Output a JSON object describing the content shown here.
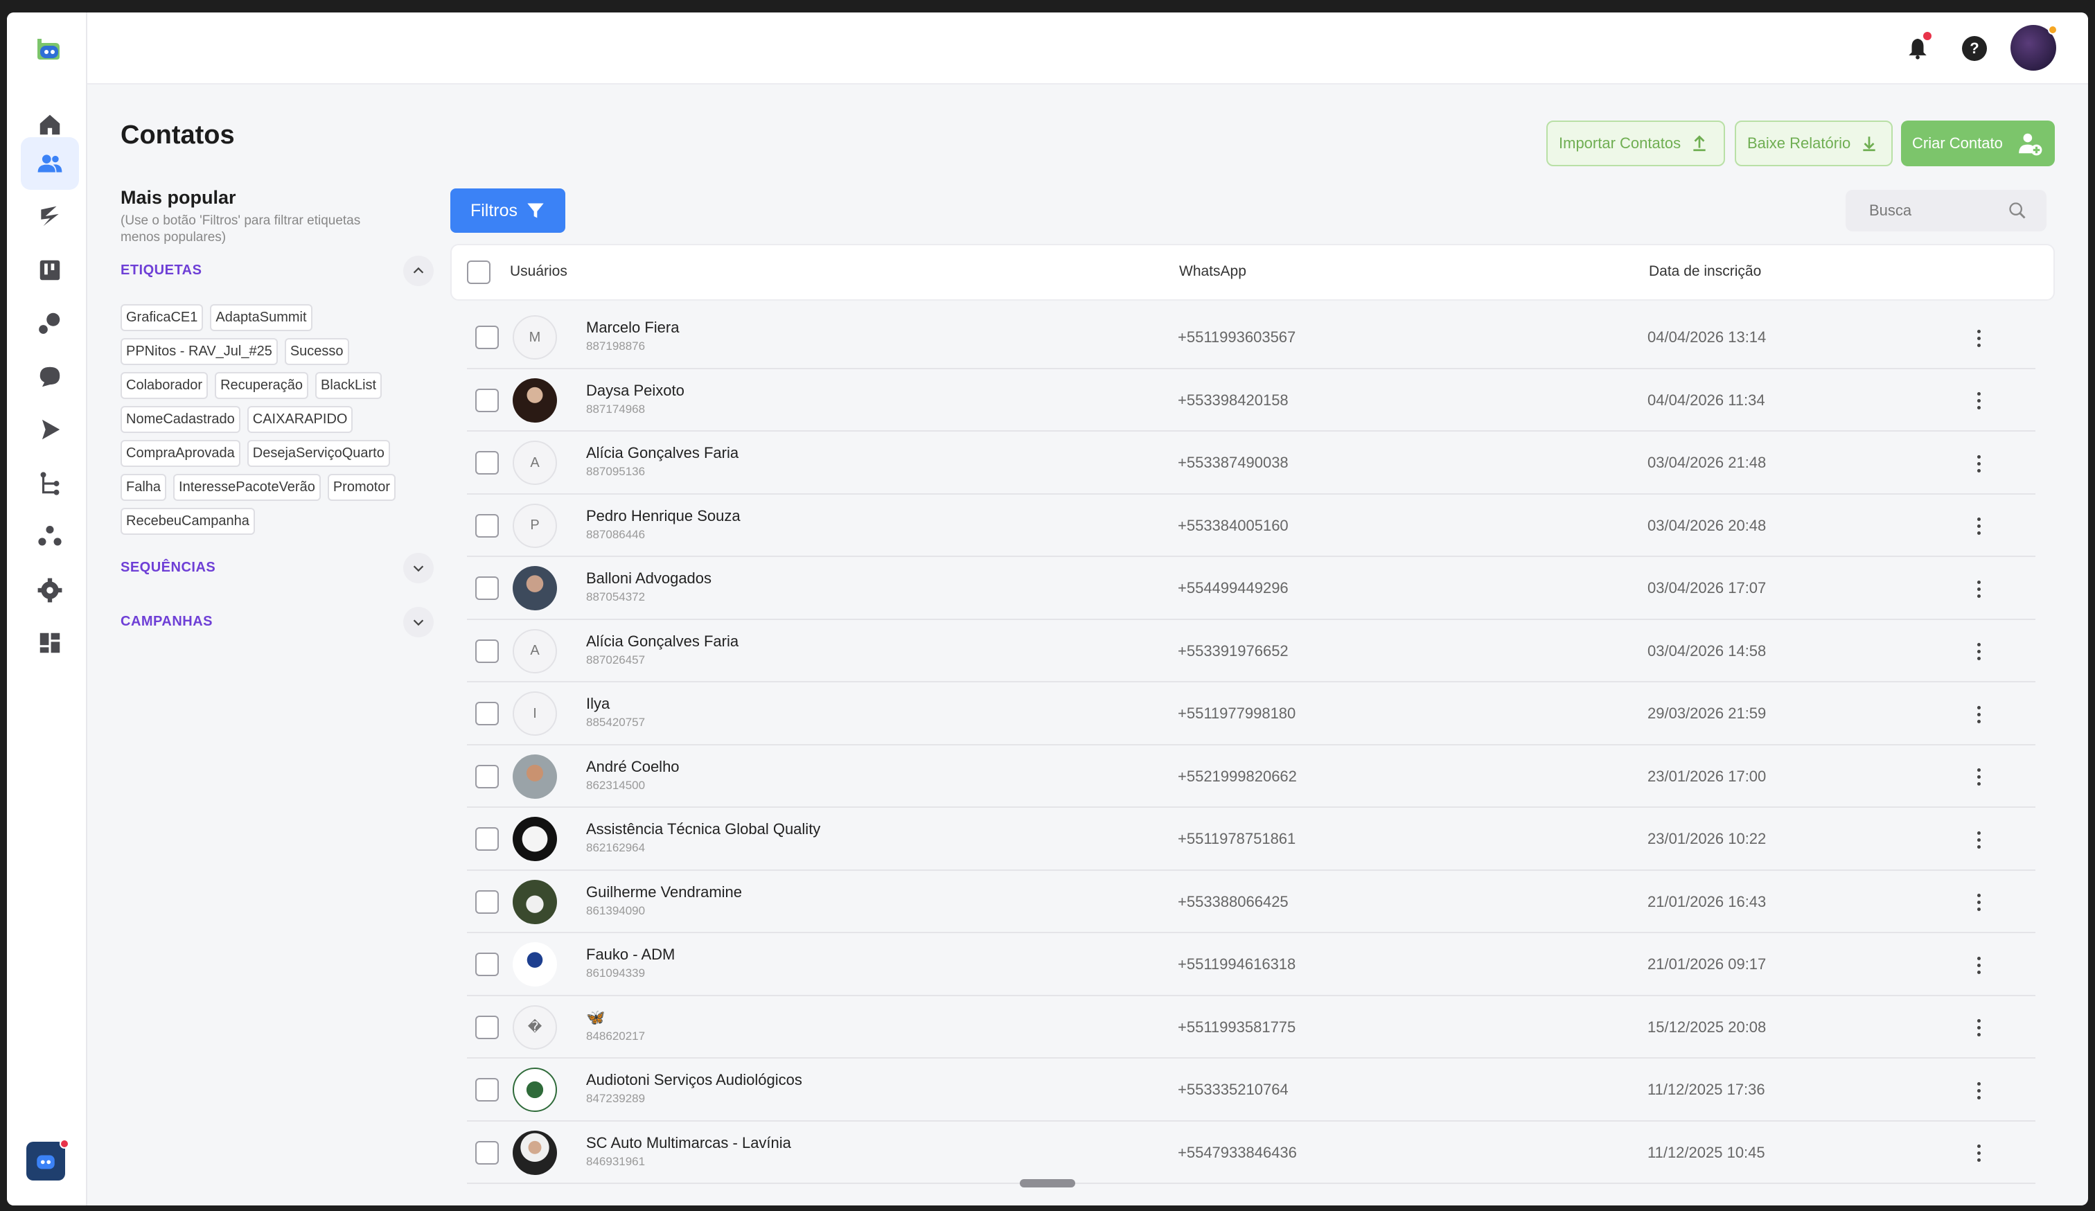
{
  "header": {
    "help_label": "?"
  },
  "page": {
    "title": "Contatos"
  },
  "actions": {
    "import_label": "Importar Contatos",
    "report_label": "Baixe Relatório",
    "create_label": "Criar Contato"
  },
  "filters": {
    "title": "Mais popular",
    "subtitle": "(Use o botão 'Filtros' para filtrar etiquetas menos populares)",
    "tags_section": "ETIQUETAS",
    "tags": [
      "GraficaCE1",
      "AdaptaSummit",
      "PPNitos - RAV_Jul_#25",
      "Sucesso",
      "Colaborador",
      "Recuperação",
      "BlackList",
      "NomeCadastrado",
      "CAIXARAPIDO",
      "CompraAprovada",
      "DesejaServiçoQuarto",
      "Falha",
      "InteressePacoteVerão",
      "Promotor",
      "RecebeuCampanha"
    ],
    "sequences_section": "SEQUÊNCIAS",
    "campaigns_section": "CAMPANHAS",
    "filter_button": "Filtros"
  },
  "search": {
    "placeholder": "Busca"
  },
  "table": {
    "columns": [
      "Usuários",
      "WhatsApp",
      "Data de inscrição"
    ],
    "rows": [
      {
        "initial": "M",
        "name": "Marcelo Fiera",
        "id": "887198876",
        "phone": "+5511993603567",
        "date": "04/04/2026 13:14"
      },
      {
        "initial": "",
        "name": "Daysa Peixoto",
        "id": "887174968",
        "phone": "+553398420158",
        "date": "04/04/2026 11:34"
      },
      {
        "initial": "A",
        "name": "Alícia Gonçalves Faria",
        "id": "887095136",
        "phone": "+553387490038",
        "date": "03/04/2026 21:48"
      },
      {
        "initial": "P",
        "name": "Pedro Henrique Souza",
        "id": "887086446",
        "phone": "+553384005160",
        "date": "03/04/2026 20:48"
      },
      {
        "initial": "",
        "name": "Balloni Advogados",
        "id": "887054372",
        "phone": "+554499449296",
        "date": "03/04/2026 17:07"
      },
      {
        "initial": "A",
        "name": "Alícia Gonçalves Faria",
        "id": "887026457",
        "phone": "+553391976652",
        "date": "03/04/2026 14:58"
      },
      {
        "initial": "I",
        "name": "Ilya",
        "id": "885420757",
        "phone": "+5511977998180",
        "date": "29/03/2026 21:59"
      },
      {
        "initial": "",
        "name": "André Coelho",
        "id": "862314500",
        "phone": "+5521999820662",
        "date": "23/01/2026 17:00"
      },
      {
        "initial": "",
        "name": "Assistência Técnica Global Quality",
        "id": "862162964",
        "phone": "+5511978751861",
        "date": "23/01/2026 10:22"
      },
      {
        "initial": "",
        "name": "Guilherme Vendramine",
        "id": "861394090",
        "phone": "+553388066425",
        "date": "21/01/2026 16:43"
      },
      {
        "initial": "",
        "name": "Fauko - ADM",
        "id": "861094339",
        "phone": "+5511994616318",
        "date": "21/01/2026 09:17"
      },
      {
        "initial": "�",
        "name": "🦋",
        "id": "848620217",
        "phone": "+5511993581775",
        "date": "15/12/2025 20:08"
      },
      {
        "initial": "",
        "name": "Audiotoni Serviços Audiológicos",
        "id": "847239289",
        "phone": "+553335210764",
        "date": "11/12/2025 17:36"
      },
      {
        "initial": "",
        "name": "SC Auto Multimarcas - Lavínia",
        "id": "846931961",
        "phone": "+5547933846436",
        "date": "11/12/2025 10:45"
      }
    ]
  },
  "colors": {
    "accent_blue": "#3b82f6",
    "accent_green": "#7cc56b",
    "section_purple": "#6e3fd6"
  }
}
